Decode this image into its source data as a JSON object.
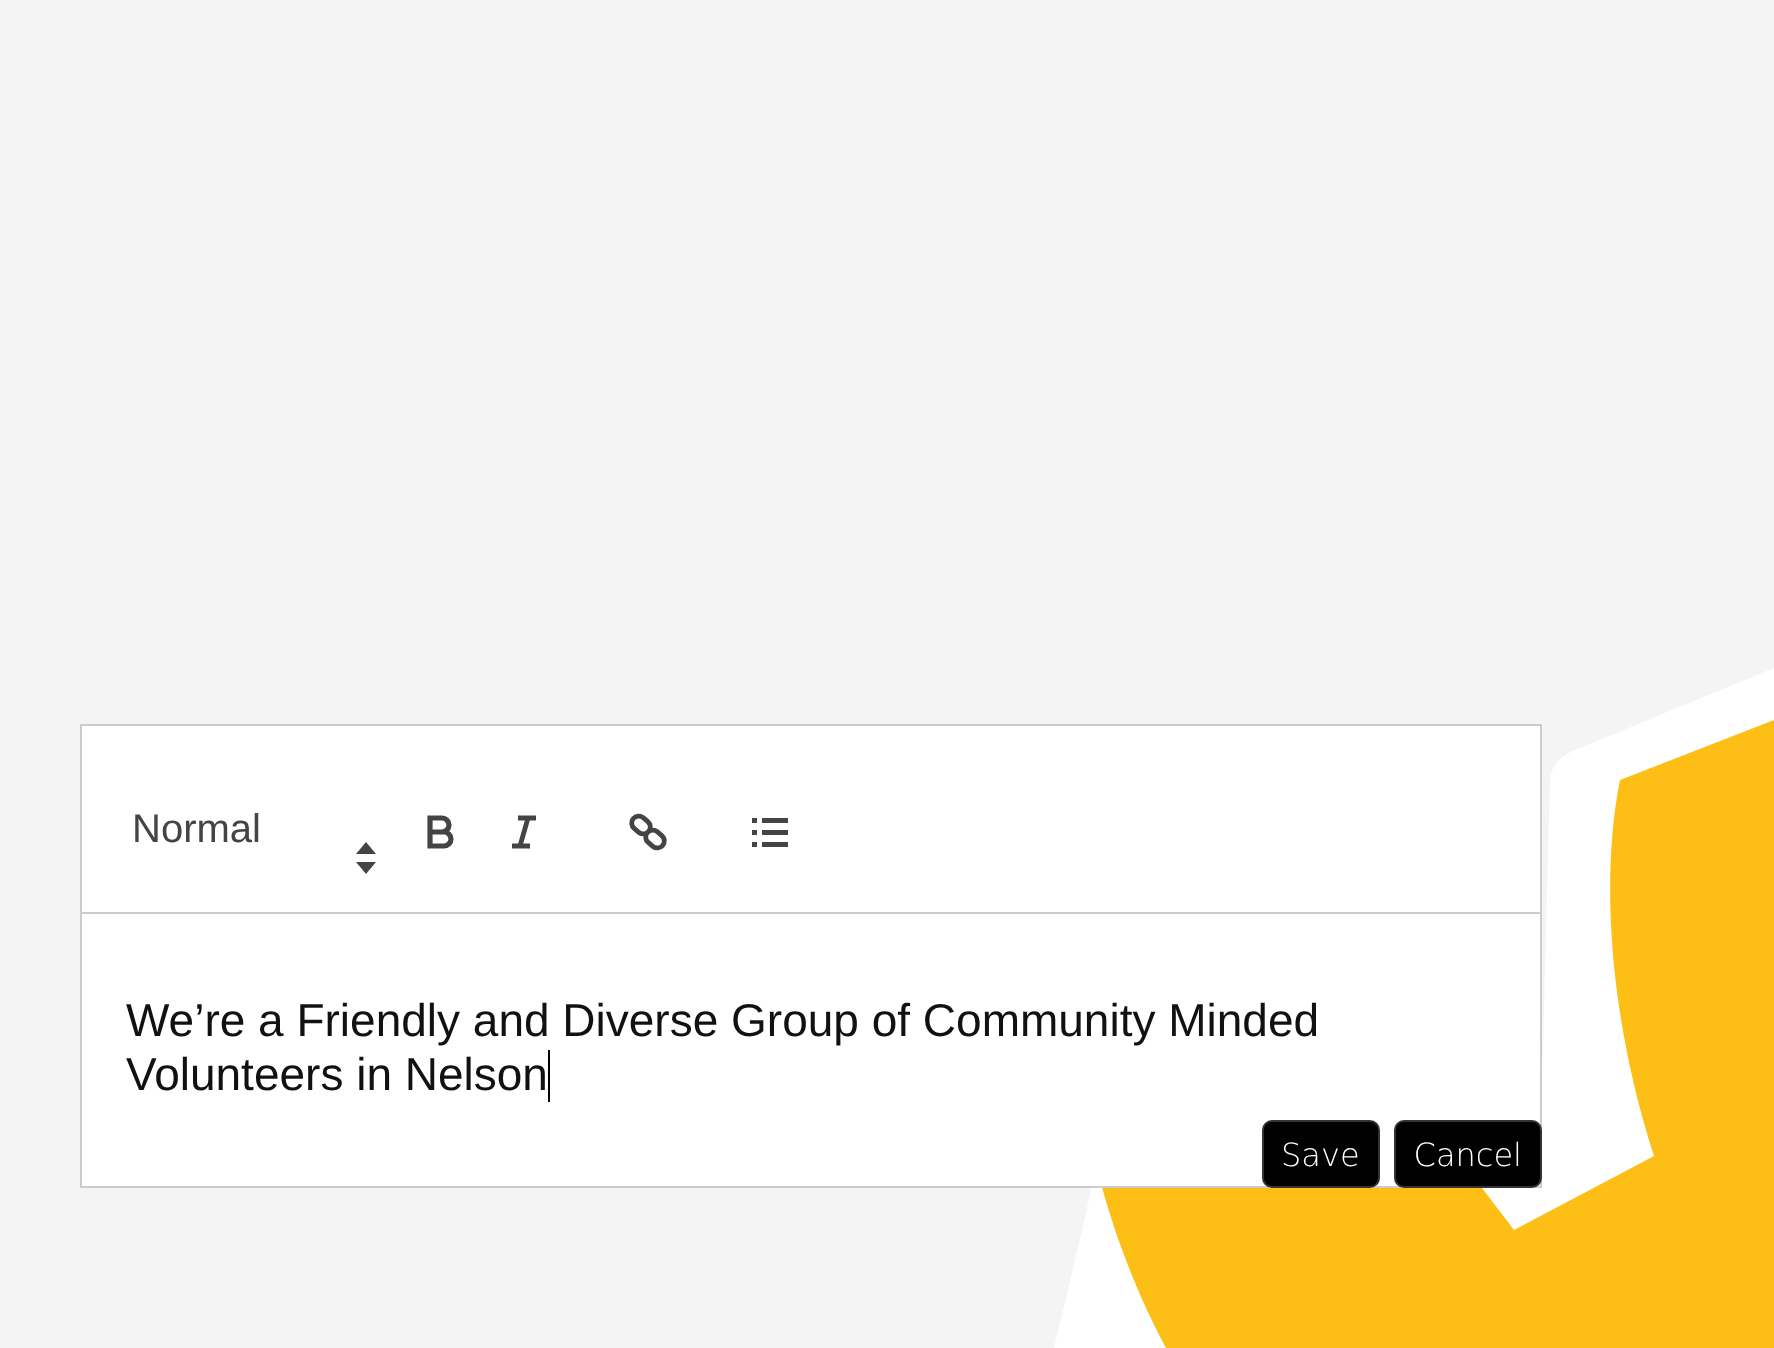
{
  "editor": {
    "format_select": {
      "value": "Normal"
    },
    "tools": [
      {
        "kind": "bold"
      },
      {
        "kind": "italic"
      },
      {
        "kind": "link"
      },
      {
        "kind": "list"
      }
    ],
    "content": "We’re a Friendly and Diverse Group of Community Minded Volunteers in Nelson",
    "caret_visible": true,
    "buttons": [
      {
        "label": "Save"
      },
      {
        "label": "Cancel"
      }
    ]
  }
}
